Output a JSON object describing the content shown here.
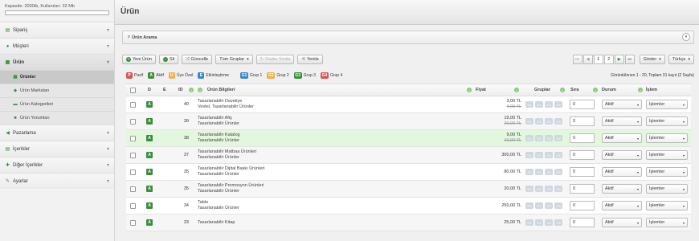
{
  "sidebar": {
    "capacity": "Kapasite: 2000tb, Kullanılan: 32 Mb",
    "items": [
      {
        "label": "Sipariş",
        "icon": "cart-icon"
      },
      {
        "label": "Müşteri",
        "icon": "user-icon"
      },
      {
        "label": "Ürün",
        "icon": "grid-icon",
        "open": true
      },
      {
        "label": "Pazarlama",
        "icon": "megaphone-icon"
      },
      {
        "label": "İçerikler",
        "icon": "document-icon"
      },
      {
        "label": "Diğer İçerikler",
        "icon": "plus-icon"
      },
      {
        "label": "Ayarlar",
        "icon": "wrench-icon"
      }
    ],
    "subitems": [
      {
        "label": "Ürünler",
        "icon": "grid-icon",
        "active": true
      },
      {
        "label": "Ürün Markaları",
        "icon": "tag-icon"
      },
      {
        "label": "Ürün Kategorileri",
        "icon": "folder-icon"
      },
      {
        "label": "Ürün Yorumları",
        "icon": "comment-icon"
      }
    ]
  },
  "header": {
    "title": "Ürün"
  },
  "search_panel": {
    "label": "Ürün Arama"
  },
  "toolbar": {
    "new": "Yeni Ürün",
    "delete": "Sil",
    "update": "Güncelle",
    "all_groups": "Tüm Gruplar",
    "sort_group": "Grubu Sırala",
    "refresh": "Yenile",
    "pages": [
      "1",
      "2"
    ],
    "show": "Göster",
    "language": "Türkçe"
  },
  "legend": {
    "items": [
      {
        "badge": "P",
        "label": "Pasif",
        "color": "#d9534f"
      },
      {
        "badge": "A",
        "label": "Aktif",
        "color": "#3c8d3c"
      },
      {
        "badge": "U",
        "label": "Üye Özel",
        "color": "#f0ad4e"
      },
      {
        "badge": "E",
        "label": "Etkinleştirme",
        "color": "#3a87c8"
      },
      {
        "badge": "G1",
        "label": "Grup 1",
        "color": "#3a87c8"
      },
      {
        "badge": "G2",
        "label": "Grup 2",
        "color": "#f0ad4e"
      },
      {
        "badge": "G3",
        "label": "Grup 3",
        "color": "#3c8d3c"
      },
      {
        "badge": "G4",
        "label": "Grup 4",
        "color": "#d9534f"
      }
    ],
    "summary": "Görüntülenen 1 - 20, Toplam 31 kayıt (2 Sayfa)"
  },
  "table": {
    "headers": {
      "d": "D",
      "e": "E",
      "id": "ID",
      "info": "Ürün Bilgileri",
      "price": "Fiyat",
      "groups": "Gruplar",
      "order": "Sıra",
      "status": "Durum",
      "action": "İşlem"
    },
    "group_badges": [
      "G1",
      "G2",
      "G3",
      "G4"
    ],
    "rows": [
      {
        "d": "A",
        "id": "40",
        "name": "Tasarlanabilir Davetiye",
        "cat": "Vestel, Tasarlanabilir Ürünler",
        "price": "3,00 TL",
        "old_price": "4,00 TL",
        "order": "0",
        "status": "Aktif",
        "action": "İşlemler"
      },
      {
        "d": "A",
        "id": "39",
        "name": "Tasarlanabilir Afiş",
        "cat": "Tasarlanabilir Ürünler",
        "price": "19,00 TL",
        "old_price": "20,00 TL",
        "order": "0",
        "status": "Aktif",
        "action": "İşlemler"
      },
      {
        "d": "A",
        "id": "38",
        "name": "Tasarlanabilir Katalog",
        "cat": "Tasarlanabilir Ürünler",
        "price": "9,00 TL",
        "old_price": "10,00 TL",
        "order": "0",
        "status": "Aktif",
        "action": "İşlemler",
        "highlight": true
      },
      {
        "d": "A",
        "id": "37",
        "name": "Tasarlanabilir Matbaa Ürünleri",
        "cat": "Tasarlanabilir Ürünler",
        "price": "300,00 TL",
        "old_price": "",
        "order": "0",
        "status": "Aktif",
        "action": "İşlemler"
      },
      {
        "d": "A",
        "id": "35",
        "name": "Tasarlanabilir Dijital Baskı Ürünleri",
        "cat": "Tasarlanabilir Ürünler",
        "price": "80,00 TL",
        "old_price": "",
        "order": "0",
        "status": "Aktif",
        "action": "İşlemler"
      },
      {
        "d": "A",
        "id": "35",
        "name": "Tasarlanabilir Promosyon Ürünleri",
        "cat": "Tasarlanabilir Ürünler",
        "price": "20,00 TL",
        "old_price": "",
        "order": "0",
        "status": "Aktif",
        "action": "İşlemler"
      },
      {
        "d": "A",
        "id": "34",
        "name": "Tablo",
        "cat": "Tasarlanabilir Ürünler",
        "price": "250,00 TL",
        "old_price": "",
        "order": "0",
        "status": "Aktif",
        "action": "İşlemler"
      },
      {
        "d": "A",
        "id": "33",
        "name": "Tasarlanabilir Kitap",
        "cat": "",
        "price": "25,00 TL",
        "old_price": "",
        "order": "0",
        "status": "Aktif",
        "action": "İşlemler"
      }
    ]
  }
}
